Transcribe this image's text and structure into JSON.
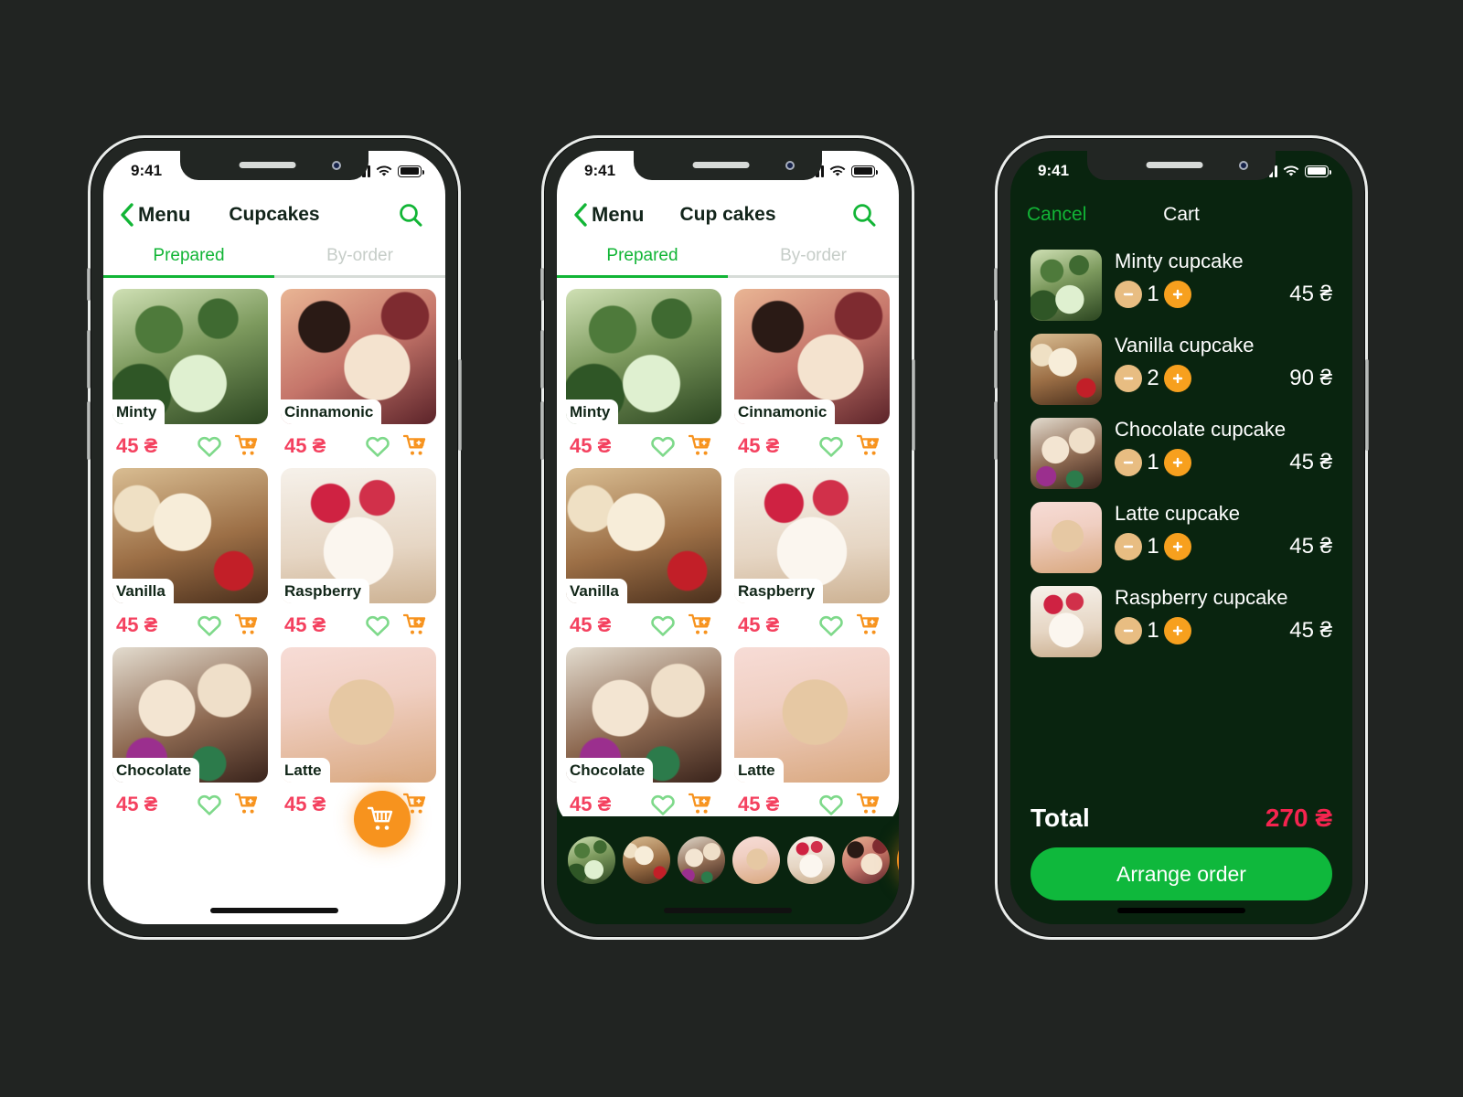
{
  "canvas": {
    "background": "#212422"
  },
  "accent": {
    "green": "#12b536",
    "orange": "#f7931e",
    "price_red": "#f4415f",
    "total_red": "#f4244f",
    "dark_green": "#09240f"
  },
  "status_bar": {
    "time": "9:41",
    "signal_icon": "signal-bars-icon",
    "wifi_icon": "wifi-icon",
    "battery_icon": "battery-icon"
  },
  "phone1": {
    "nav": {
      "back_label": "Menu",
      "title": "Cupcakes",
      "back_icon": "chevron-left-icon",
      "search_icon": "search-icon"
    },
    "tabs": [
      {
        "label": "Prepared",
        "active": true
      },
      {
        "label": "By-order",
        "active": false
      }
    ],
    "products": [
      {
        "name": "Minty",
        "price": "45 ₴",
        "image": "minty-cupcakes-photo"
      },
      {
        "name": "Cinnamonic",
        "price": "45 ₴",
        "image": "cinnamonic-cupcake-photo"
      },
      {
        "name": "Vanilla",
        "price": "45 ₴",
        "image": "vanilla-cupcake-photo"
      },
      {
        "name": "Raspberry",
        "price": "45 ₴",
        "image": "raspberry-cupcake-photo"
      },
      {
        "name": "Chocolate",
        "price": "45 ₴",
        "image": "chocolate-cupcake-photo"
      },
      {
        "name": "Latte",
        "price": "45 ₴",
        "image": "latte-cupcake-photo"
      }
    ],
    "fab_icon": "shopping-cart-icon"
  },
  "phone2": {
    "nav": {
      "back_label": "Menu",
      "title": "Cup cakes",
      "back_icon": "chevron-left-icon",
      "search_icon": "search-icon"
    },
    "tabs": [
      {
        "label": "Prepared",
        "active": true
      },
      {
        "label": "By-order",
        "active": false
      }
    ],
    "products": [
      {
        "name": "Minty",
        "price": "45 ₴",
        "image": "minty-cupcakes-photo"
      },
      {
        "name": "Cinnamonic",
        "price": "45 ₴",
        "image": "cinnamonic-cupcake-photo"
      },
      {
        "name": "Vanilla",
        "price": "45 ₴",
        "image": "vanilla-cupcake-photo"
      },
      {
        "name": "Raspberry",
        "price": "45 ₴",
        "image": "raspberry-cupcake-photo"
      },
      {
        "name": "Chocolate",
        "price": "45 ₴",
        "image": "chocolate-cupcake-photo"
      },
      {
        "name": "Latte",
        "price": "45 ₴",
        "image": "latte-cupcake-photo"
      }
    ],
    "bottom_bar": {
      "thumbs": [
        "minty-cupcakes-photo",
        "vanilla-cupcake-photo",
        "chocolate-cupcake-photo",
        "latte-cupcake-photo",
        "raspberry-cupcake-photo",
        "cinnamonic-cupcake-photo"
      ],
      "cart_icon": "shopping-cart-icon"
    }
  },
  "phone3": {
    "nav": {
      "cancel_label": "Cancel",
      "title": "Cart"
    },
    "items": [
      {
        "name": "Minty cupcake",
        "qty": "1",
        "line_total": "45 ₴",
        "image": "minty-cupcakes-photo"
      },
      {
        "name": "Vanilla cupcake",
        "qty": "2",
        "line_total": "90 ₴",
        "image": "vanilla-cupcake-photo"
      },
      {
        "name": "Chocolate cupcake",
        "qty": "1",
        "line_total": "45 ₴",
        "image": "chocolate-cupcake-photo"
      },
      {
        "name": "Latte cupcake",
        "qty": "1",
        "line_total": "45 ₴",
        "image": "latte-cupcake-photo"
      },
      {
        "name": "Raspberry cupcake",
        "qty": "1",
        "line_total": "45 ₴",
        "image": "raspberry-cupcake-photo"
      }
    ],
    "total": {
      "label": "Total",
      "value": "270 ₴"
    },
    "order_button": "Arrange order",
    "minus_icon": "minus-icon",
    "plus_icon": "plus-icon"
  }
}
